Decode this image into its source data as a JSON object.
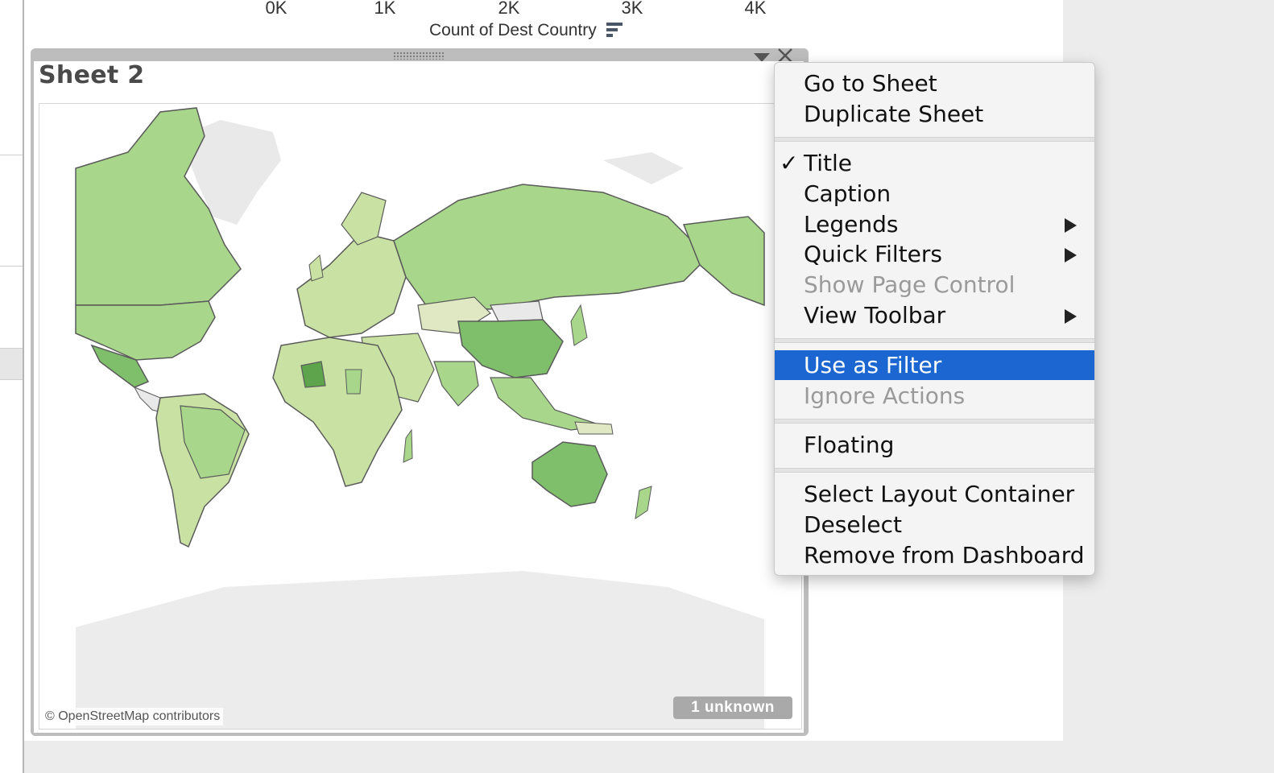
{
  "axis": {
    "ticks": [
      "0K",
      "1K",
      "2K",
      "3K",
      "4K"
    ],
    "title": "Count of Dest Country",
    "sort_icon": "sort-descending-icon"
  },
  "sheet": {
    "title": "Sheet 2",
    "dropdown_icon": "chevron-down-icon",
    "close_icon": "close-icon",
    "map_credit": "© OpenStreetMap contributors",
    "unknown_badge": "1 unknown"
  },
  "context_menu": {
    "go_to_sheet": "Go to Sheet",
    "duplicate_sheet": "Duplicate Sheet",
    "title": "Title",
    "title_checked": "✓",
    "caption": "Caption",
    "legends": "Legends",
    "quick_filters": "Quick Filters",
    "show_page_control": "Show Page Control",
    "view_toolbar": "View Toolbar",
    "use_as_filter": "Use as Filter",
    "ignore_actions": "Ignore Actions",
    "floating": "Floating",
    "select_layout_container": "Select Layout Container",
    "deselect": "Deselect",
    "remove_from_dashboard": "Remove from Dashboard"
  },
  "colors": {
    "menu_highlight": "#1b66d0",
    "map_light": "#c9e2a4",
    "map_mid": "#a8d68a",
    "map_dark": "#7fbf6b",
    "map_darkest": "#5ea44c",
    "no_data": "#e9e9e9"
  }
}
